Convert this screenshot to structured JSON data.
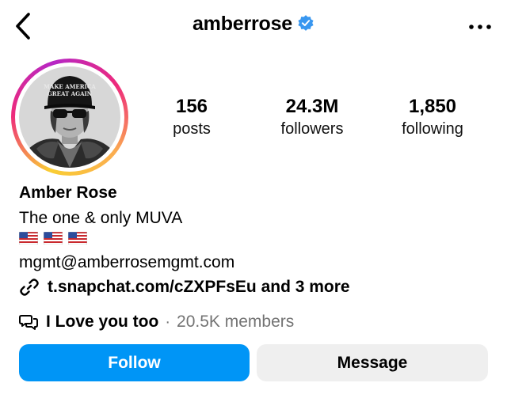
{
  "header": {
    "back_icon": "chevron-left-icon",
    "username": "amberrose",
    "verified_icon": "verified-badge-icon",
    "more_icon": "more-horizontal-icon"
  },
  "profile": {
    "avatar_alt": "profile picture",
    "stats": [
      {
        "value": "156",
        "label": "posts"
      },
      {
        "value": "24.3M",
        "label": "followers"
      },
      {
        "value": "1,850",
        "label": "following"
      }
    ],
    "name": "Amber Rose",
    "tagline": "The one & only MUVA",
    "flags": [
      "🇺🇸",
      "🇺🇸",
      "🇺🇸"
    ],
    "email": "mgmt@amberrosemgmt.com",
    "link": {
      "icon": "link-icon",
      "text": "t.snapchat.com/cZXPFsEu and 3 more"
    },
    "channel": {
      "icon": "broadcast-channel-icon",
      "name": "I Love you too",
      "separator": "·",
      "members": "20.5K members"
    },
    "hat_text_line1": "MAKE AMERICA",
    "hat_text_line2": "GREAT AGAIN"
  },
  "actions": {
    "follow_label": "Follow",
    "message_label": "Message"
  },
  "colors": {
    "follow_bg": "#0095f6",
    "message_bg": "#efefef",
    "verified": "#0095f6",
    "muted": "#737373"
  }
}
